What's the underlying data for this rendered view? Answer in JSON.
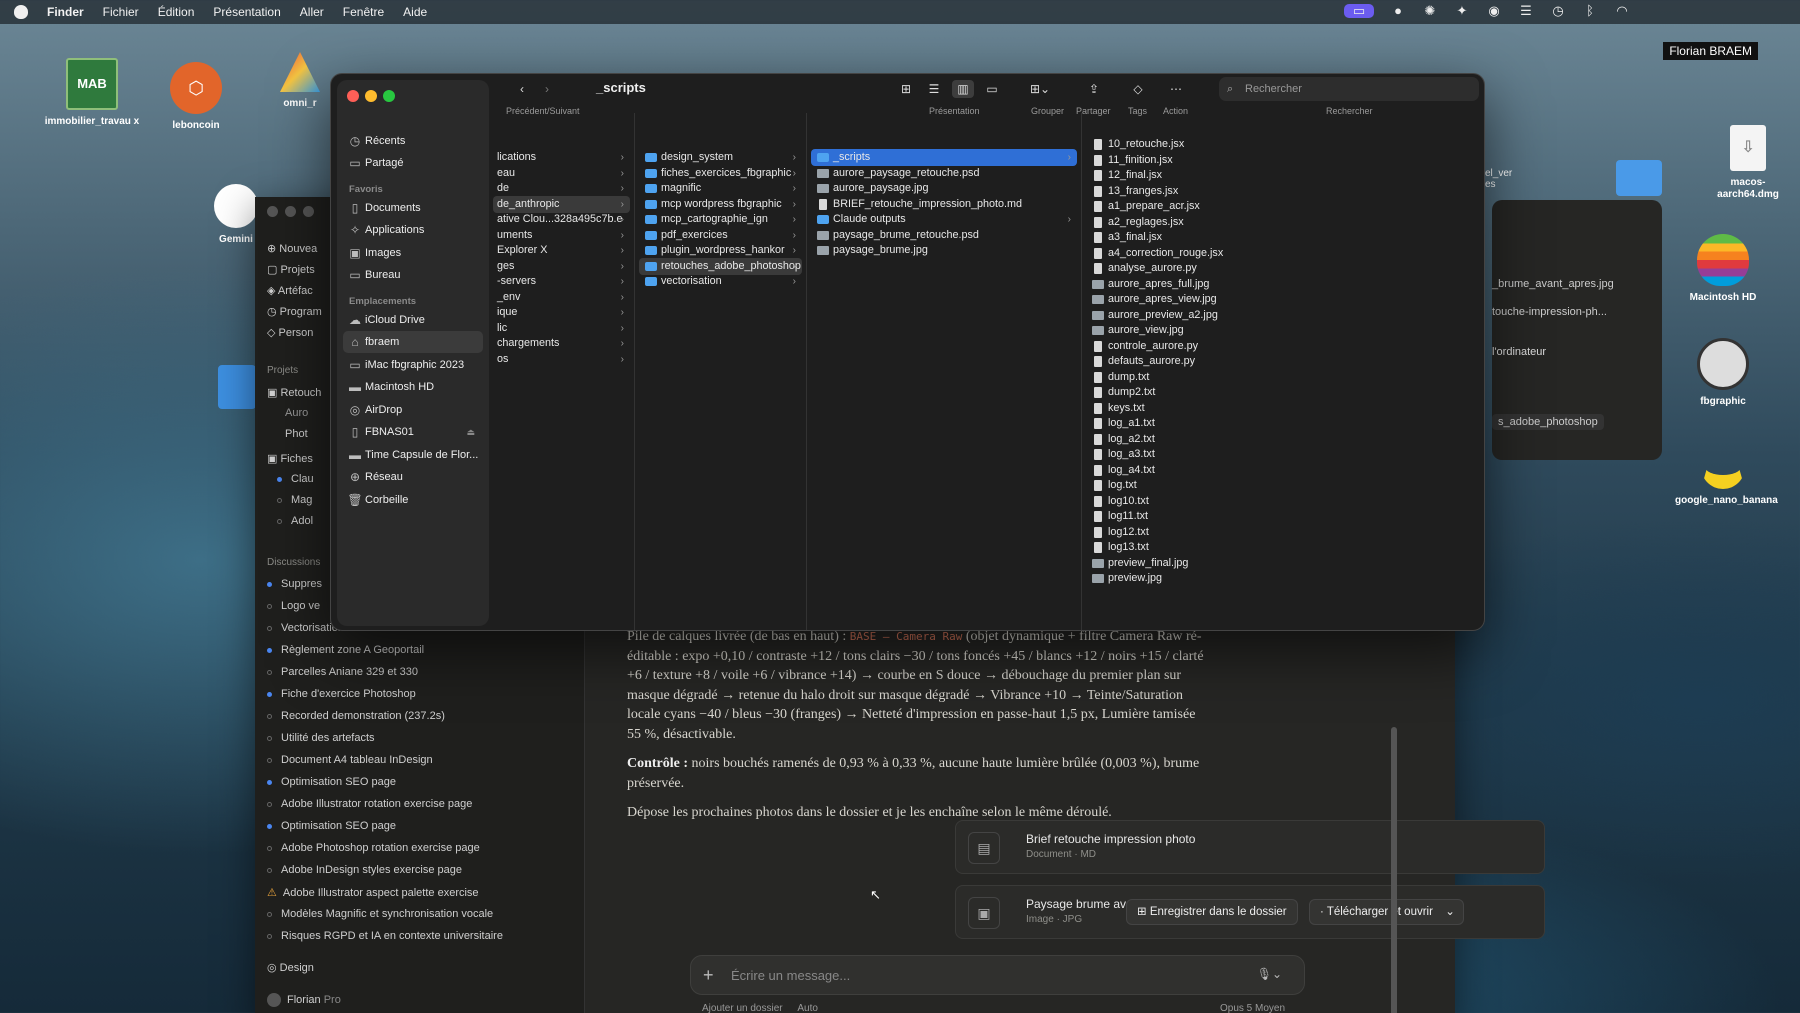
{
  "menubar": {
    "app": "Finder",
    "items": [
      "Fichier",
      "Édition",
      "Présentation",
      "Aller",
      "Fenêtre",
      "Aide"
    ]
  },
  "username": "Florian BRAEM",
  "desktop_icons": [
    {
      "label": "immobilier_travau x",
      "icon": "mab-logo-icon"
    },
    {
      "label": "leboncoin",
      "icon": "leboncoin-icon"
    },
    {
      "label": "omni_r",
      "icon": "app-icon"
    },
    {
      "label": "Gemini",
      "icon": "gemini-icon"
    },
    {
      "label": "macos-aarch64.dmg",
      "icon": "dmg-file-icon"
    },
    {
      "label": "Macintosh HD",
      "icon": "apple-logo-icon"
    },
    {
      "label": "fbgraphic",
      "icon": "pencil-app-icon"
    },
    {
      "label": "google_nano_banana",
      "icon": "banana-icon"
    }
  ],
  "finder": {
    "title": "_scripts",
    "nav_label": "Précédent/Suivant",
    "toolbar": {
      "presentation": "Présentation",
      "group": "Grouper",
      "share": "Partager",
      "tags": "Tags",
      "action": "Action",
      "search_label": "Rechercher",
      "search_placeholder": "Rechercher"
    },
    "sidebar": {
      "top": [
        "Récents",
        "Partagé"
      ],
      "favs_title": "Favoris",
      "favs": [
        "Documents",
        "Applications",
        "Images",
        "Bureau"
      ],
      "locs_title": "Emplacements",
      "locs": [
        "iCloud Drive",
        "fbraem",
        "iMac fbgraphic 2023",
        "Macintosh HD",
        "AirDrop",
        "FBNAS01",
        "Time Capsule de Flor...",
        "Réseau",
        "Corbeille"
      ]
    },
    "col1": [
      "lications",
      "eau",
      "de",
      "de_anthropic",
      "ative Clou...328a495c7b.e",
      "uments",
      "Explorer X",
      "ges",
      "-servers",
      "_env",
      "ique",
      "lic",
      "chargements",
      "os"
    ],
    "col2": [
      "design_system",
      "fiches_exercices_fbgraphic",
      "magnific",
      "mcp wordpress fbgraphic",
      "mcp_cartographie_ign",
      "pdf_exercices",
      "plugin_wordpress_hankor",
      "retouches_adobe_photoshop",
      "vectorisation"
    ],
    "col3": [
      "_scripts",
      "aurore_paysage_retouche.psd",
      "aurore_paysage.jpg",
      "BRIEF_retouche_impression_photo.md",
      "Claude outputs",
      "paysage_brume_retouche.psd",
      "paysage_brume.jpg"
    ],
    "col4": [
      "10_retouche.jsx",
      "11_finition.jsx",
      "12_final.jsx",
      "13_franges.jsx",
      "a1_prepare_acr.jsx",
      "a2_reglages.jsx",
      "a3_final.jsx",
      "a4_correction_rouge.jsx",
      "analyse_aurore.py",
      "aurore_apres_full.jpg",
      "aurore_apres_view.jpg",
      "aurore_preview_a2.jpg",
      "aurore_view.jpg",
      "controle_aurore.py",
      "defauts_aurore.py",
      "dump.txt",
      "dump2.txt",
      "keys.txt",
      "log_a1.txt",
      "log_a2.txt",
      "log_a3.txt",
      "log_a4.txt",
      "log.txt",
      "log10.txt",
      "log11.txt",
      "log12.txt",
      "log13.txt",
      "preview_final.jpg",
      "preview.jpg"
    ]
  },
  "claude": {
    "sidebar_items": [
      "Nouvea",
      "Projets",
      "Artéfac",
      "Program",
      "Person"
    ],
    "projects_title": "Projets",
    "projects": [
      "Retouch",
      "Auro",
      "Phot",
      "Fiches",
      "Clau",
      "Mag",
      "Adol"
    ],
    "discussions_title": "Discussions",
    "discussions": [
      "Suppres",
      "Logo ve",
      "Vectorisation fichiers illustrator",
      "Règlement zone A Geoportail",
      "Parcelles Aniane 329 et 330",
      "Fiche d'exercice Photoshop",
      "Recorded demonstration (237.2s)",
      "Utilité des artefacts",
      "Document A4 tableau InDesign",
      "Optimisation SEO page",
      "Adobe Illustrator rotation exercise page",
      "Optimisation SEO page",
      "Adobe Photoshop rotation exercise page",
      "Adobe InDesign styles exercise page",
      "Adobe Illustrator aspect palette exercise",
      "Modèles Magnific et synchronisation vocale",
      "Risques RGPD et IA en contexte universitaire"
    ],
    "design": "Design",
    "user": "Florian",
    "plan": "Pro",
    "message": {
      "p1_a": "Pile de calques livrée (de bas en haut) : ",
      "p1_code": "BASE – Camera Raw",
      "p1_b": " (objet dynamique + filtre Camera Raw ré-éditable : expo +0,10 / contraste +12 / tons clairs −30 / tons foncés +45 / blancs +12 / noirs +15 / clarté +6 / texture +8 / voile +6 / vibrance +14) → courbe en S douce → débouchage du premier plan sur masque dégradé → retenue du halo droit sur masque dégradé → Vibrance +10 → Teinte/Saturation locale cyans −40 / bleus −30 (franges) → Netteté d'impression en passe-haut 1,5 px, Lumière tamisée 55 %, désactivable.",
      "p2_label": "Contrôle :",
      "p2_text": " noirs bouchés ramenés de 0,93 % à 0,33 %, aucune haute lumière brûlée (0,003 %), brume préservée.",
      "p3": "Dépose les prochaines photos dans le dossier et je les enchaîne selon le même déroulé."
    },
    "attachments": [
      {
        "title": "Brief retouche impression photo",
        "sub": "Document · MD"
      },
      {
        "title": "Paysage brume avant apres",
        "sub": "Image · JPG"
      }
    ],
    "save_btn": "Enregistrer dans le dossier",
    "download_btn": "Télécharger et ouvrir",
    "composer_placeholder": "Écrire un message...",
    "footer_left": "Ajouter un dossier",
    "footer_auto": "Auto",
    "footer_model": "Opus 5",
    "footer_mode": "Moyen",
    "right_panel": [
      "_brume_avant_apres.jpg",
      "touche-impression-ph...",
      "l'ordinateur",
      "s_adobe_photoshop"
    ],
    "partial_label": "el_ver es"
  }
}
